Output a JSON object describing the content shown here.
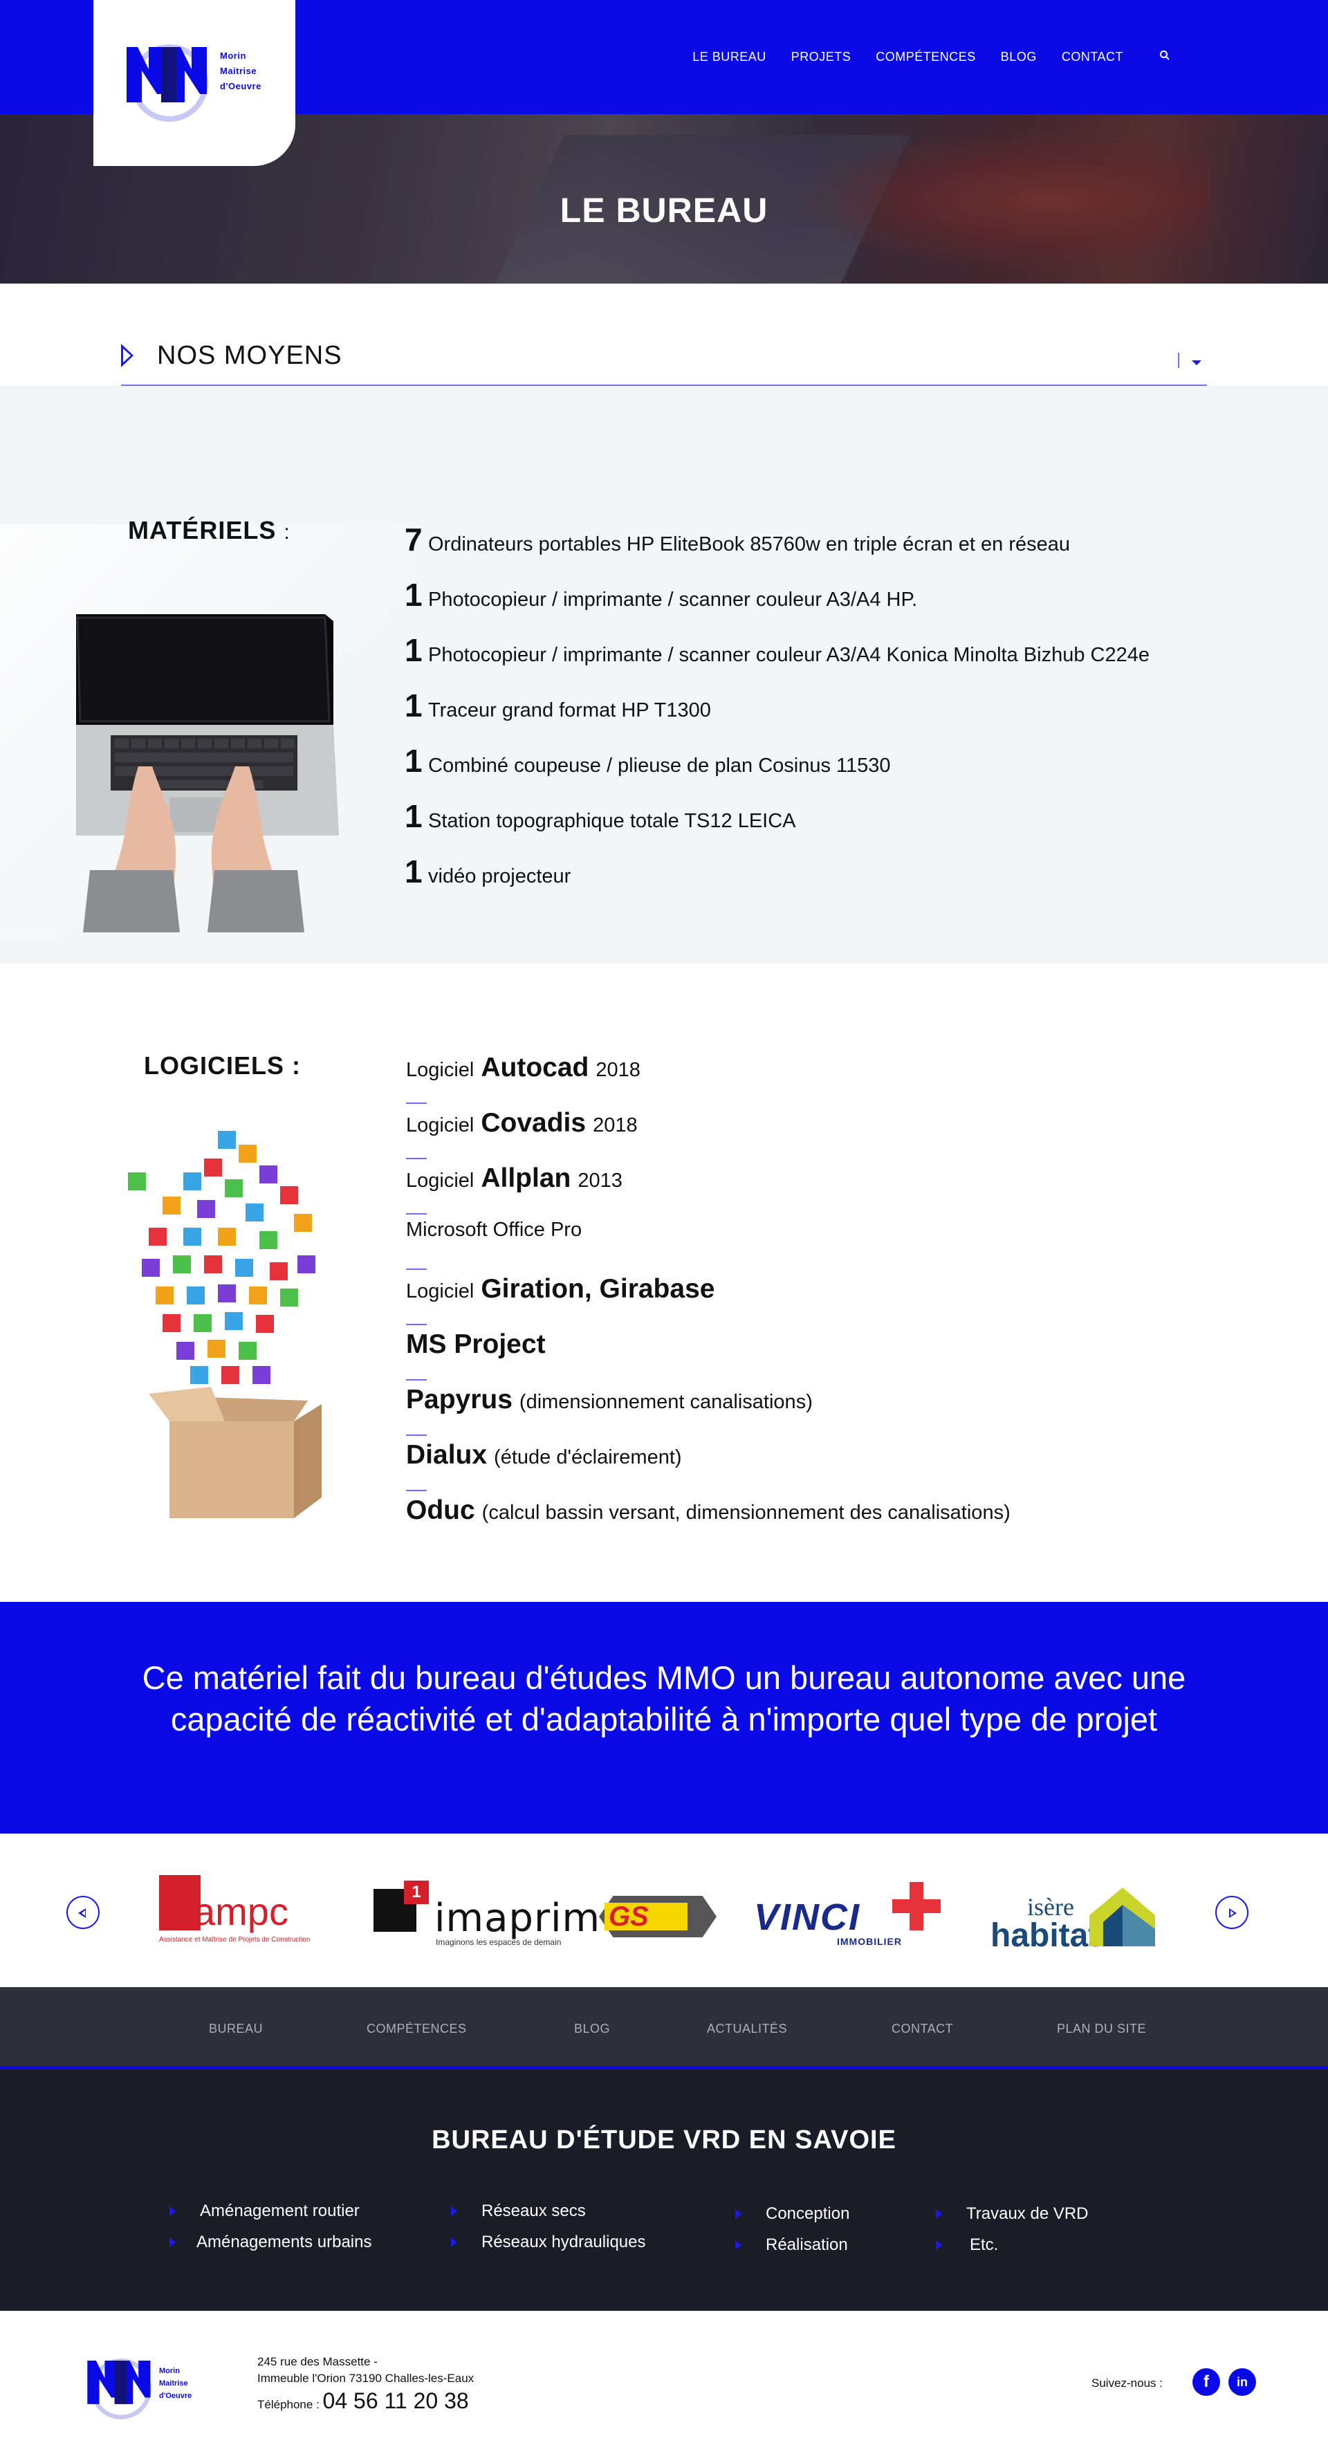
{
  "brand": {
    "line1": "Morin",
    "line2": "Maitrise",
    "line3": "d'Oeuvre"
  },
  "nav": [
    "LE BUREAU",
    "PROJETS",
    "COMPÉTENCES",
    "BLOG",
    "CONTACT"
  ],
  "nav_search_icon": "search-icon",
  "hero": {
    "title": "LE BUREAU"
  },
  "selector": {
    "label": "NOS MOYENS"
  },
  "materiels": {
    "heading": "MATÉRIELS",
    "colon": ":",
    "items": [
      {
        "count": "7",
        "text": "Ordinateurs portables HP EliteBook 85760w en triple écran et en réseau"
      },
      {
        "count": "1",
        "text": "Photocopieur / imprimante / scanner couleur A3/A4 HP."
      },
      {
        "count": "1",
        "text": "Photocopieur / imprimante / scanner couleur A3/A4 Konica Minolta Bizhub C224e"
      },
      {
        "count": "1",
        "text": " Traceur grand format HP T1300"
      },
      {
        "count": "1",
        "text": "Combiné coupeuse / plieuse de plan Cosinus 11530"
      },
      {
        "count": "1",
        "text": "Station topographique totale TS12 LEICA"
      },
      {
        "count": "1",
        "text": " vidéo projecteur"
      }
    ]
  },
  "logiciels": {
    "heading": "LOGICIELS :",
    "items": [
      {
        "pre": "Logiciel",
        "name": "Autocad",
        "post": "2018"
      },
      {
        "pre": "Logiciel",
        "name": "Covadis",
        "post": "2018"
      },
      {
        "pre": "Logiciel",
        "name": "Allplan",
        "post": "2013"
      },
      {
        "pre": "Microsoft Office Pro",
        "name": "",
        "post": ""
      },
      {
        "pre": "Logiciel",
        "name": "Giration, Girabase",
        "post": ""
      },
      {
        "pre": "",
        "name": "MS Project",
        "post": ""
      },
      {
        "pre": "",
        "name": "Papyrus",
        "post": "(dimensionnement canalisations)"
      },
      {
        "pre": "",
        "name": "Dialux",
        "post": "(étude d'éclairement)"
      },
      {
        "pre": "",
        "name": "Oduc",
        "post": "(calcul bassin versant, dimensionnement des canalisations)"
      }
    ]
  },
  "banner": {
    "text": "Ce matériel fait du bureau d'études MMO un bureau autonome avec une capacité de réactivité et d'adaptabilité à n'importe quel type de projet"
  },
  "partners": {
    "ampc": {
      "name": "ampc",
      "tag": "Assistance et Maîtrise de Projets de Construction"
    },
    "imaprim": {
      "mark": "1",
      "name": "imaprim",
      "tag": "Imaginons les espaces de demain"
    },
    "gs": {
      "name": "GS"
    },
    "vinci": {
      "name": "VINCI",
      "sub": "IMMOBILIER"
    },
    "isere": {
      "line1": "isère",
      "line2": "habitat"
    }
  },
  "footer_nav": [
    "BUREAU",
    "COMPÉTENCES",
    "BLOG",
    "ACTUALITÉS",
    "CONTACT",
    "PLAN DU SITE"
  ],
  "footer_services": {
    "title": "BUREAU D'ÉTUDE VRD EN SAVOIE",
    "items": [
      "Aménagement routier",
      "Aménagements urbains",
      "Réseaux secs",
      "Réseaux hydrauliques",
      "Conception",
      "Réalisation",
      "Travaux de VRD",
      "Etc."
    ]
  },
  "footer": {
    "address1": "245 rue des Massette -",
    "address2": "Immeuble l'Orion 73190 Challes-les-Eaux",
    "tel_label": "Téléphone :",
    "tel": "04 56 11 20 38",
    "follow": "Suivez-nous :"
  },
  "colors": {
    "primary": "#0a0ae6",
    "dark": "#1a1c27",
    "footer_nav": "#2d3039",
    "accent_red": "#d4202a"
  }
}
